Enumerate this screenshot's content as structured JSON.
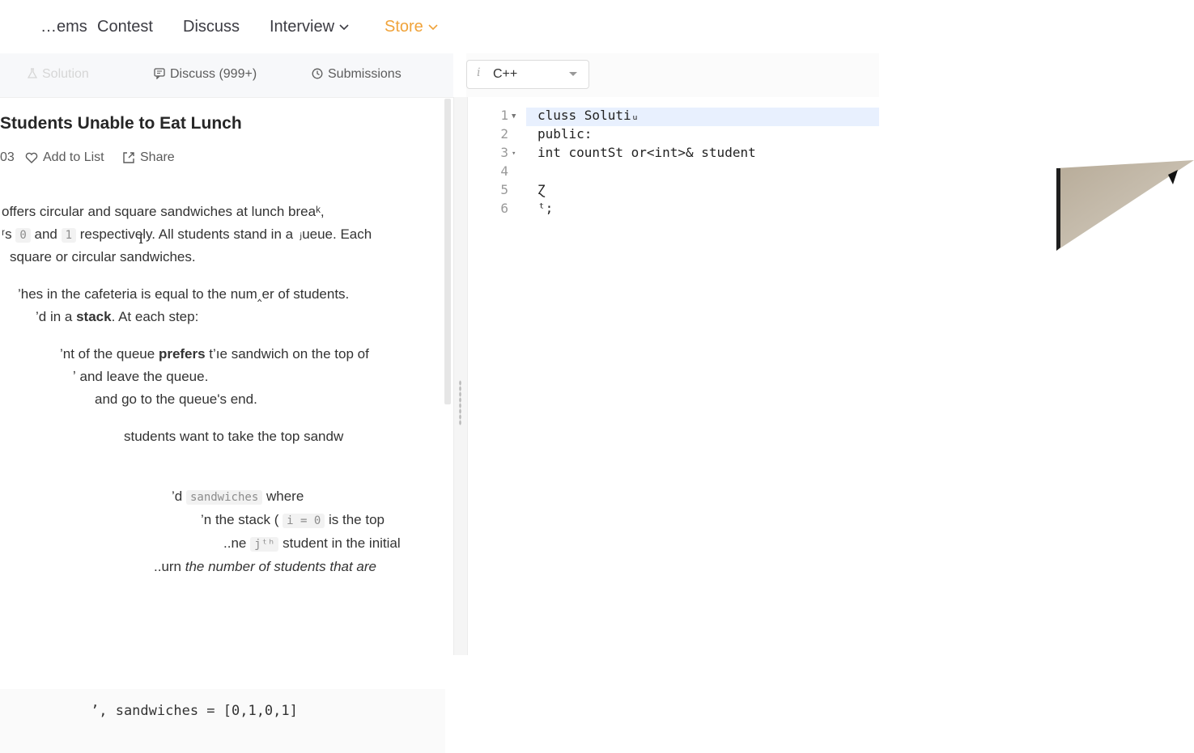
{
  "nav": {
    "items": [
      "…ems",
      "Contest",
      "Discuss",
      "Interview",
      "Store"
    ],
    "store_color": "#f0a33a"
  },
  "tabs": {
    "solution": "Solution",
    "discuss": "Discuss (999+)",
    "submissions": "Submissions"
  },
  "problem": {
    "title": "Students Unable to Eat Lunch",
    "likes_fragment": "03",
    "add_to_list": "Add to List",
    "share": "Share",
    "paragraphs": {
      "p1_l1": "offers circular and square sandwiches at lunch breaᵏ,",
      "p1_l2_a": "ʳs",
      "p1_l2_code0": "0",
      "p1_l2_and": "and",
      "p1_l2_code1": "1",
      "p1_l2_b": "respec​tively. All students stand in a  ⱼueue. Each",
      "p1_l3": "square or circular sandwiches.",
      "p2_l1": "’hes in the cafeteria is equal to the num‸er of students.",
      "p2_l2_a": "’d in a ",
      "p2_l2_bold": "stack",
      "p2_l2_b": ". At each step:",
      "p3_l1_a": "’nt of the queue ",
      "p3_l1_bold": "prefers",
      "p3_l1_b": " t’ıe sandwich on the top of",
      "p3_l2": "ʼ and leave the queue.",
      "p3_l3": "and go to the queue's end.",
      "p4_l1": "students want to take the top sandw",
      "p5_l1_a": "’d",
      "p5_l1_code": "sandwiches",
      "p5_l1_b": "where",
      "p5_l2_a": "’n the stack (",
      "p5_l2_code": "i = 0",
      "p5_l2_b": "is the top",
      "p5_l3_a": "..ne",
      "p5_l3_code": "jᵗʰ",
      "p5_l3_b": "student in the initial",
      "p5_l4_a": "..urn ",
      "p5_l4_italic": "the number of students that are"
    },
    "example_fragment": "ʼ, sandwiches = [0,1,0,1]"
  },
  "editor": {
    "language": "C++",
    "lines": [
      {
        "n": "1",
        "text": "cluss Solutiᵤ",
        "fold": true
      },
      {
        "n": "2",
        "text": "public:",
        "fold": false
      },
      {
        "n": "3",
        "text": "    int countSt            or<int>& student",
        "fold": true
      },
      {
        "n": "4",
        "text": "",
        "fold": false
      },
      {
        "n": "5",
        "text": "    Ɀ",
        "fold": false
      },
      {
        "n": "6",
        "text": "ᵗ;",
        "fold": false
      }
    ]
  }
}
